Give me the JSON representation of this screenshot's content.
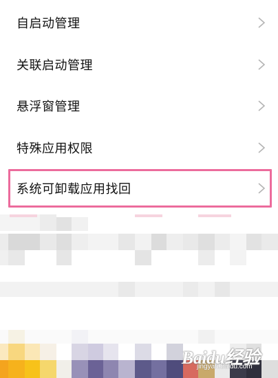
{
  "menu": {
    "items": [
      {
        "label": "自启动管理"
      },
      {
        "label": "关联启动管理"
      },
      {
        "label": "悬浮窗管理"
      },
      {
        "label": "特殊应用权限"
      },
      {
        "label": "系统可卸载应用找回"
      }
    ]
  },
  "watermark": {
    "logo_text": "Baidu经验",
    "url": "jingyan.baidu.com"
  },
  "colors": {
    "highlight_border": "#ec6b9c",
    "label_text": "#111111",
    "chevron": "#b5b5b5"
  },
  "icons": {
    "menu_item_chevron": "chevron-right-icon"
  }
}
